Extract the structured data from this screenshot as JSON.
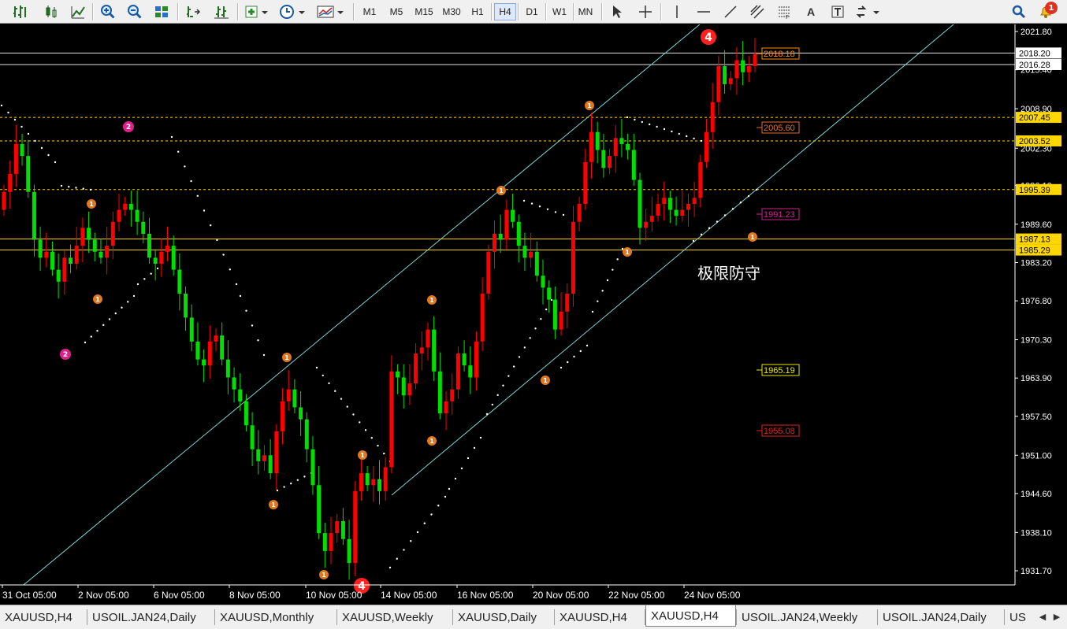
{
  "toolbar": {
    "timeframes": [
      "M1",
      "M5",
      "M15",
      "M30",
      "H1",
      "H4",
      "D1",
      "W1",
      "MN"
    ],
    "text_tool_label": "A",
    "notification_count": "1"
  },
  "chart": {
    "price_axis_labels": [
      "2021.80",
      "2015.40",
      "2008.90",
      "2002.30",
      "1996.10",
      "1989.60",
      "1983.20",
      "1976.80",
      "1970.30",
      "1963.90",
      "1957.50",
      "1951.00",
      "1944.60",
      "1938.10",
      "1931.70"
    ],
    "time_axis_labels": [
      "31 Oct 05:00",
      "2 Nov 05:00",
      "6 Nov 05:00",
      "8 Nov 05:00",
      "10 Nov 05:00",
      "14 Nov 05:00",
      "16 Nov 05:00",
      "20 Nov 05:00",
      "22 Nov 05:00",
      "24 Nov 05:00"
    ],
    "price_tags": [
      {
        "price": "2018.20",
        "style": "white"
      },
      {
        "price": "2016.28",
        "style": "white"
      },
      {
        "price": "2007.45",
        "style": "yellow"
      },
      {
        "price": "2003.52",
        "style": "yellow"
      },
      {
        "price": "1995.39",
        "style": "yellow"
      },
      {
        "price": "1987.13",
        "style": "yellow"
      },
      {
        "price": "1985.29",
        "style": "yellow"
      }
    ],
    "box_labels": [
      {
        "text": "2018.18",
        "color": "#ff8c00"
      },
      {
        "text": "2005.60",
        "color": "#e07030"
      },
      {
        "text": "1991.23",
        "color": "#d02090"
      },
      {
        "text": "1965.19",
        "color": "#e8e800"
      },
      {
        "text": "1955.08",
        "color": "#e02020"
      }
    ],
    "annotation_text": "极限防守",
    "wave_labels": [
      {
        "label": "4",
        "kind": "major-red"
      },
      {
        "label": "4",
        "kind": "major-red"
      },
      {
        "label": "2",
        "kind": "magenta"
      },
      {
        "label": "2",
        "kind": "magenta"
      },
      {
        "label": "1",
        "kind": "orange"
      },
      {
        "label": "1",
        "kind": "orange"
      },
      {
        "label": "1",
        "kind": "orange"
      },
      {
        "label": "1",
        "kind": "orange"
      },
      {
        "label": "1",
        "kind": "orange"
      },
      {
        "label": "1",
        "kind": "orange"
      },
      {
        "label": "1",
        "kind": "orange"
      },
      {
        "label": "1",
        "kind": "orange"
      },
      {
        "label": "1",
        "kind": "orange"
      },
      {
        "label": "1",
        "kind": "orange"
      },
      {
        "label": "1",
        "kind": "orange"
      },
      {
        "label": "1",
        "kind": "orange"
      },
      {
        "label": "1",
        "kind": "orange"
      }
    ],
    "colors": {
      "up": "#ff0000",
      "down": "#00e000",
      "channel": "#7fd4d4",
      "grid": "#ffffff",
      "yellow_line": "#ffd700",
      "dots": "#ffffff"
    }
  },
  "tabs": [
    {
      "label": "XAUUSD,H4",
      "active": false
    },
    {
      "label": "USOIL.JAN24,Daily",
      "active": false
    },
    {
      "label": "XAUUSD,Monthly",
      "active": false
    },
    {
      "label": "XAUUSD,Weekly",
      "active": false
    },
    {
      "label": "XAUUSD,Daily",
      "active": false
    },
    {
      "label": "XAUUSD,H4",
      "active": false
    },
    {
      "label": "XAUUSD,H4",
      "active": true
    },
    {
      "label": "USOIL.JAN24,Weekly",
      "active": false
    },
    {
      "label": "USOIL.JAN24,Daily",
      "active": false
    },
    {
      "label": "US",
      "active": false
    }
  ]
}
